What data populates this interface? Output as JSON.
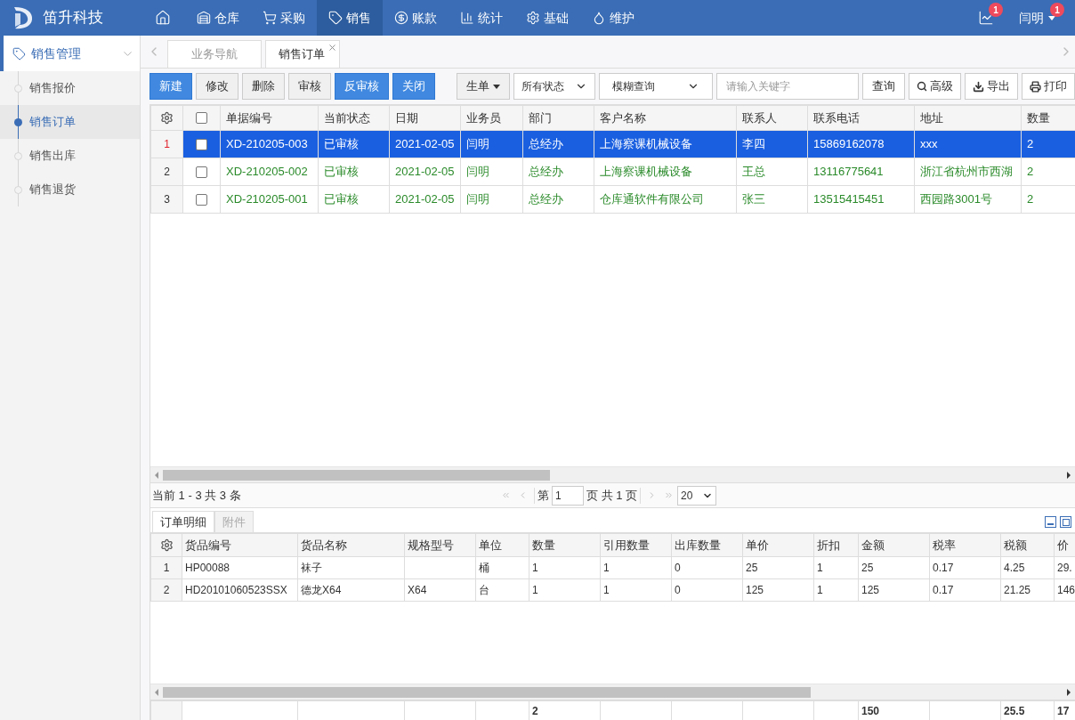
{
  "brand": "笛升科技",
  "nav": [
    {
      "label": "仓库",
      "selected": false
    },
    {
      "label": "采购",
      "selected": false
    },
    {
      "label": "销售",
      "selected": true
    },
    {
      "label": "账款",
      "selected": false
    },
    {
      "label": "统计",
      "selected": false
    },
    {
      "label": "基础",
      "selected": false
    },
    {
      "label": "维护",
      "selected": false
    }
  ],
  "notifications": {
    "count": "1"
  },
  "user": {
    "name": "闫明",
    "badge": "1"
  },
  "sidebar": {
    "title": "销售管理",
    "expanded": true,
    "items": [
      {
        "label": "销售报价",
        "selected": false
      },
      {
        "label": "销售订单",
        "selected": true
      },
      {
        "label": "销售出库",
        "selected": false
      },
      {
        "label": "销售退货",
        "selected": false
      }
    ]
  },
  "tabs": [
    {
      "label": "业务导航",
      "selected": false,
      "closable": false
    },
    {
      "label": "销售订单",
      "selected": true,
      "closable": true
    }
  ],
  "toolbar": {
    "buttons": [
      {
        "label": "新建",
        "primary": true
      },
      {
        "label": "修改",
        "primary": false
      },
      {
        "label": "删除",
        "primary": false
      },
      {
        "label": "审核",
        "primary": false
      },
      {
        "label": "反审核",
        "primary": true
      },
      {
        "label": "关闭",
        "primary": true
      }
    ],
    "generate": "生单",
    "status_select": "所有状态",
    "mode_select": "模糊查询",
    "search_placeholder": "请输入关键字",
    "query": "查询",
    "advanced": "高级",
    "export": "导出",
    "print": "打印"
  },
  "orders": {
    "all_checked": false,
    "columns": [
      "单据编号",
      "当前状态",
      "日期",
      "业务员",
      "部门",
      "客户名称",
      "联系人",
      "联系电话",
      "地址",
      "数量"
    ],
    "rows": [
      {
        "index": "1",
        "selected": true,
        "checked": false,
        "cells": [
          "XD-210205-003",
          "已审核",
          "2021-02-05",
          "闫明",
          "总经办",
          "上海察课机械设备",
          "李四",
          "15869162078",
          "xxx",
          "2"
        ]
      },
      {
        "index": "2",
        "selected": false,
        "checked": false,
        "cells": [
          "XD-210205-002",
          "已审核",
          "2021-02-05",
          "闫明",
          "总经办",
          "上海察课机械设备",
          "王总",
          "13116775641",
          "浙江省杭州市西湖",
          "2"
        ]
      },
      {
        "index": "3",
        "selected": false,
        "checked": false,
        "cells": [
          "XD-210205-001",
          "已审核",
          "2021-02-05",
          "闫明",
          "总经办",
          "仓库通软件有限公司",
          "张三",
          "13515415451",
          "西园路3001号",
          "2"
        ]
      }
    ]
  },
  "pager": {
    "summary": "当前 1 - 3 共 3 条",
    "page_prefix": "第",
    "page": "1",
    "page_suffix": "页 共 1 页",
    "page_size": "20"
  },
  "detail_tabs": [
    {
      "label": "订单明细",
      "selected": true
    },
    {
      "label": "附件",
      "selected": false
    }
  ],
  "details": {
    "columns": [
      "货品编号",
      "货品名称",
      "规格型号",
      "单位",
      "数量",
      "引用数量",
      "出库数量",
      "单价",
      "折扣",
      "金额",
      "税率",
      "税额",
      "价"
    ],
    "rows": [
      {
        "index": "1",
        "cells": [
          "HP00088",
          "袜子",
          "",
          "桶",
          "1",
          "1",
          "0",
          "25",
          "1",
          "25",
          "0.17",
          "4.25",
          "29."
        ]
      },
      {
        "index": "2",
        "cells": [
          "HD20101060523SSX",
          "德龙X64",
          "X64",
          "台",
          "1",
          "1",
          "0",
          "125",
          "1",
          "125",
          "0.17",
          "21.25",
          "146"
        ]
      }
    ],
    "totals": {
      "quantity": "2",
      "amount": "150",
      "tax": "25.5",
      "column_13": "17"
    }
  }
}
